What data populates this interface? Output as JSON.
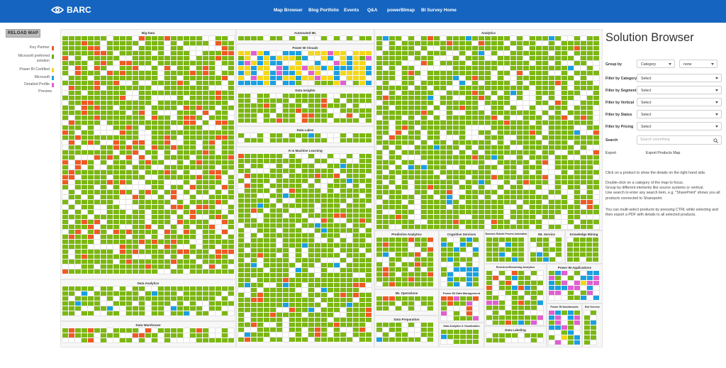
{
  "brand": {
    "logo_text": "BARC"
  },
  "nav": {
    "items": [
      {
        "label": "Map Browser"
      },
      {
        "label": "Blog Portfolio"
      },
      {
        "label": "Events"
      },
      {
        "label": "Q&A"
      },
      {
        "label": "powerBImap"
      },
      {
        "label": "BI Survey Home"
      }
    ]
  },
  "reload_label": "RELOAD MAP",
  "legend": [
    {
      "label": "Key Partner",
      "color": "#ee5a24"
    },
    {
      "label": "Microsoft preferred solution",
      "color": "#6aaa05"
    },
    {
      "label": "Power BI Certified",
      "color": "#f4d71a"
    },
    {
      "label": "Microsoft",
      "color": "#1aa0e0"
    },
    {
      "label": "Detailed Profile",
      "color": "#e15fd0"
    },
    {
      "label": "Preview",
      "color": ""
    }
  ],
  "map": {
    "colors": {
      "green": "#7cb712",
      "orange": "#ee5a24",
      "blue": "#1aa0e0",
      "yellow": "#f4d71a",
      "pink": "#e15fd0",
      "empty": "#ffffff"
    },
    "regions": [
      {
        "title": "Big Data"
      },
      {
        "title": "Data Analytics"
      },
      {
        "title": "Data Warehouse"
      },
      {
        "title": "Automated ML"
      },
      {
        "title": "Power BI Visuals"
      },
      {
        "title": "Data Insights"
      },
      {
        "title": "Data Lakes"
      },
      {
        "title": "AI & Machine Learning"
      },
      {
        "title": "Analytics"
      },
      {
        "title": "Predictive Analytics"
      },
      {
        "title": "Cognitive Services"
      },
      {
        "title": "Business Robotic Process Automation"
      },
      {
        "title": "ML Service"
      },
      {
        "title": "Knowledge Mining"
      },
      {
        "title": "Real-time/Streaming Analytics"
      },
      {
        "title": "Power BI Applications"
      },
      {
        "title": "ML Operations"
      },
      {
        "title": "Power BI Data Management"
      },
      {
        "title": "Data Preparation"
      },
      {
        "title": "Data Analytics & Visualization"
      },
      {
        "title": "Data Labeling"
      },
      {
        "title": "Power BI Dashboards"
      },
      {
        "title": "Bot Service"
      }
    ]
  },
  "panel": {
    "title": "Solution Browser",
    "group_by": {
      "label": "Group by",
      "value1": "Category",
      "value2": "none"
    },
    "filters": [
      {
        "label": "Filter by Category",
        "value": "Select"
      },
      {
        "label": "Filter by Segment",
        "value": "Select"
      },
      {
        "label": "Filter by Vertical",
        "value": "Select"
      },
      {
        "label": "Filter by Status",
        "value": "Select"
      },
      {
        "label": "Filter by Pricing",
        "value": "Select"
      }
    ],
    "search": {
      "label": "Search",
      "placeholder": "Search something"
    },
    "export": {
      "label": "Export",
      "link": "Export Products Map"
    },
    "help": [
      "Click on a product to show the details on the right hand side.",
      "Double-click on a category of the map to focus.\nGroup by different elements like source systems or vertical.\nUse search to enter any search item, e.g. \"SharePoint\" shows you all products connected to Sharepoint.",
      "You can multi-select products by pressing CTRL while selecting and then export a PDF with details to all selected products."
    ]
  }
}
